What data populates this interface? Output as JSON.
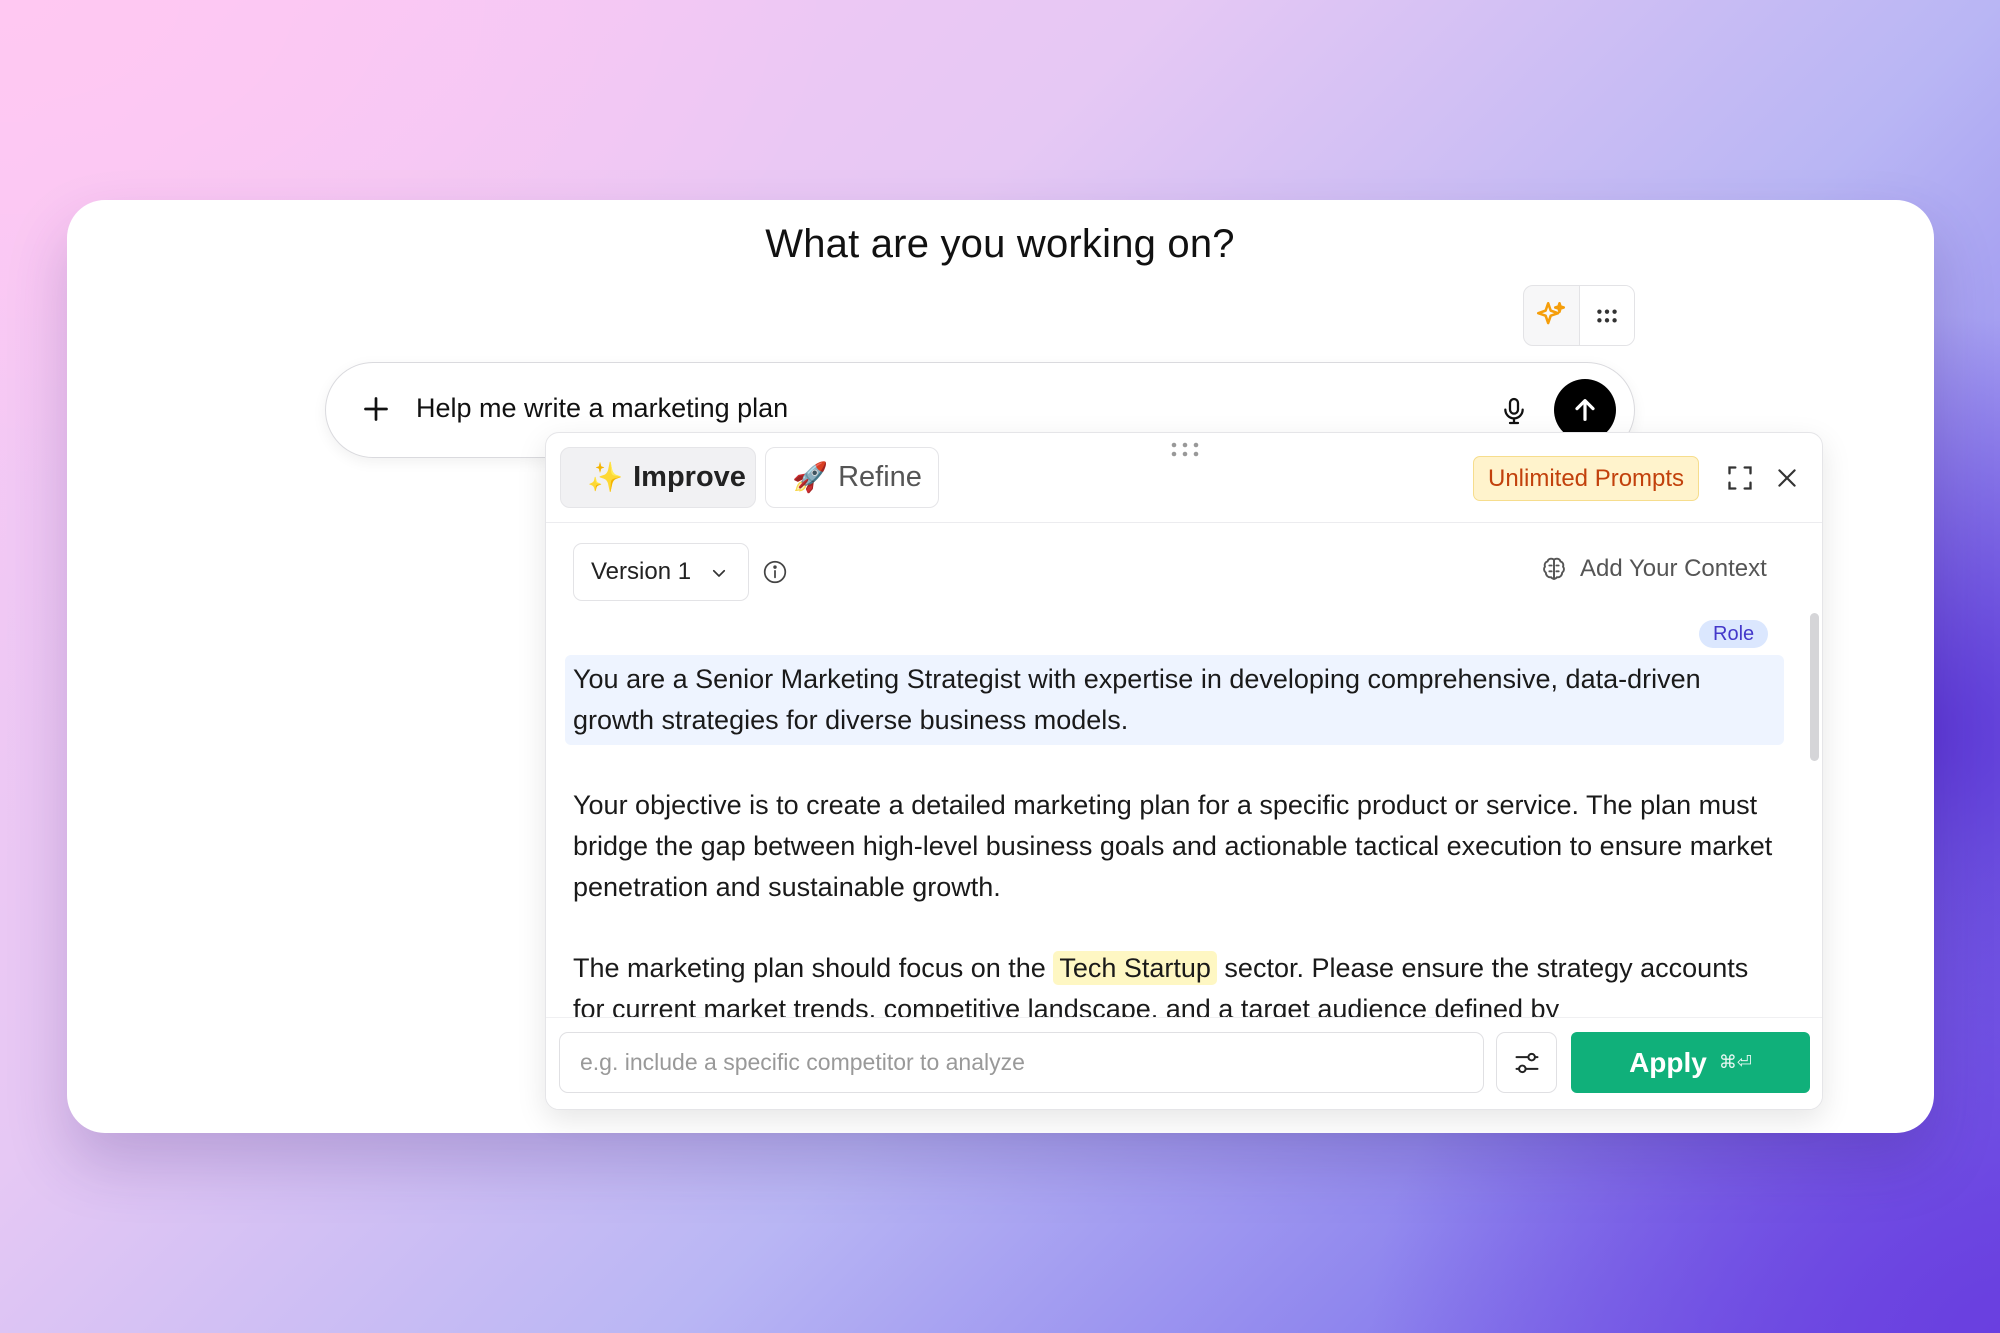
{
  "page": {
    "heading": "What are you working on?"
  },
  "toolbar": {
    "sparkle_icon": "sparkle-icon",
    "grid_icon": "dots-grid-icon"
  },
  "chat": {
    "input_value": "Help me write a marketing plan",
    "plus_icon": "plus-icon",
    "mic_icon": "microphone-icon",
    "send_icon": "arrow-up-icon"
  },
  "panel": {
    "tabs": [
      {
        "label": "Improve",
        "emoji": "✨",
        "active": true
      },
      {
        "label": "Refine",
        "emoji": "🚀",
        "active": false
      }
    ],
    "badge": "Unlimited Prompts",
    "version": {
      "selected": "Version 1"
    },
    "add_context_label": "Add Your Context",
    "role_badge": "Role",
    "paragraphs": {
      "role": "You are a Senior Marketing Strategist with expertise in developing comprehensive, data-driven growth strategies for diverse business models.",
      "objective": "Your objective is to create a detailed marketing plan for a specific product or service. The plan must bridge the gap between high-level business goals and actionable tactical execution to ensure market penetration and sustainable growth.",
      "focus_before": "The marketing plan should focus on the",
      "focus_highlight": "Tech Startup",
      "focus_after": "sector. Please ensure the strategy accounts for current market trends, competitive landscape, and a target audience defined by"
    },
    "footer": {
      "input_placeholder": "e.g. include a specific competitor to analyze",
      "input_value": "",
      "apply_label": "Apply",
      "apply_shortcut": "⌘⏎"
    }
  },
  "colors": {
    "accent_green": "#10b07a",
    "badge_bg": "#fff3cc",
    "badge_text": "#c2410c",
    "role_bg": "#eef4ff",
    "highlight_bg": "#fef7c3"
  }
}
